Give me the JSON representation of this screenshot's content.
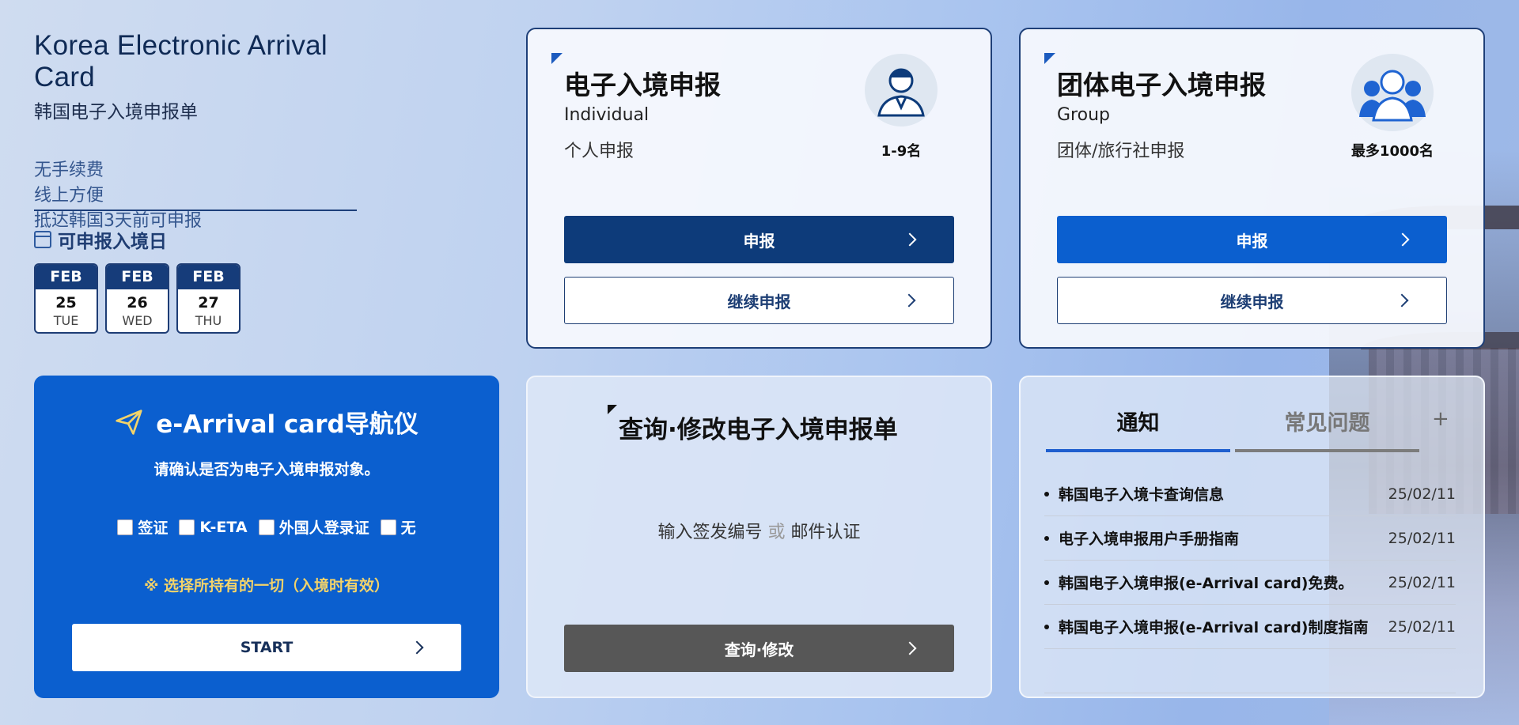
{
  "intro": {
    "title": "Korea Electronic Arrival Card",
    "subtitle": "韩国电子入境申报单",
    "features": [
      "无手续费",
      "线上方便",
      "抵达韩国3天前可申报"
    ],
    "available_label": "可申报入境日",
    "dates": [
      {
        "month": "FEB",
        "day": "25",
        "weekday": "TUE"
      },
      {
        "month": "FEB",
        "day": "26",
        "weekday": "WED"
      },
      {
        "month": "FEB",
        "day": "27",
        "weekday": "THU"
      }
    ]
  },
  "individual": {
    "title": "电子入境申报",
    "en": "Individual",
    "zh": "个人申报",
    "count": "1-9名",
    "apply_label": "申报",
    "continue_label": "继续申报"
  },
  "group": {
    "title": "团体电子入境申报",
    "en": "Group",
    "zh": "团体/旅行社申报",
    "count": "最多1000名",
    "apply_label": "申报",
    "continue_label": "继续申报"
  },
  "navigator": {
    "title": "e-Arrival card导航仪",
    "question": "请确认是否为电子入境申报对象。",
    "options": [
      "签证",
      "K-ETA",
      "外国人登录证",
      "无"
    ],
    "note": "※ 选择所持有的一切（入境时有效）",
    "start_label": "START"
  },
  "query": {
    "title": "查询·修改电子入境申报单",
    "hint_a": "输入签发编号",
    "hint_or": "或",
    "hint_b": "邮件认证",
    "button_label": "查询·修改"
  },
  "notice": {
    "tabs": [
      "通知",
      "常见问题"
    ],
    "plus": "+",
    "items": [
      {
        "title": "韩国电子入境卡查询信息",
        "date": "25/02/11"
      },
      {
        "title": "电子入境申报用户手册指南",
        "date": "25/02/11"
      },
      {
        "title": "韩国电子入境申报(e-Arrival card)免费。",
        "date": "25/02/11"
      },
      {
        "title": "韩国电子入境申报(e-Arrival card)制度指南",
        "date": "25/02/11"
      }
    ]
  },
  "colors": {
    "navy": "#0d3b7a",
    "blue": "#0b5fcf",
    "gold": "#f3d36a",
    "gray_button": "#575757"
  }
}
